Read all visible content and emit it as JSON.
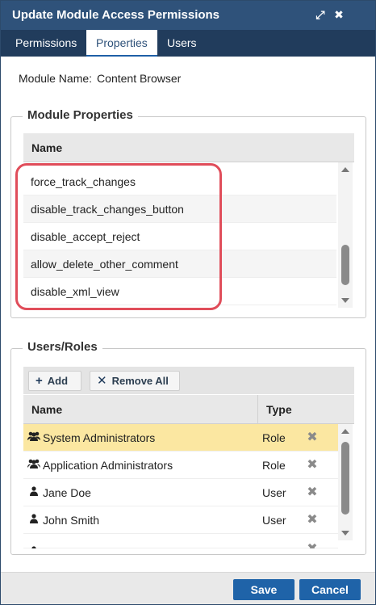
{
  "dialog": {
    "title": "Update Module Access Permissions",
    "expand_icon": "⤢",
    "close_icon": "✖"
  },
  "tabs": [
    {
      "label": "Permissions",
      "active": false
    },
    {
      "label": "Properties",
      "active": true
    },
    {
      "label": "Users",
      "active": false
    }
  ],
  "module": {
    "label": "Module Name:",
    "value": "Content Browser"
  },
  "module_properties": {
    "legend": "Module Properties",
    "column_header": "Name",
    "rows": [
      "force_track_changes",
      "disable_track_changes_button",
      "disable_accept_reject",
      "allow_delete_other_comment",
      "disable_xml_view"
    ]
  },
  "users_roles": {
    "legend": "Users/Roles",
    "add_label": "Add",
    "remove_all_label": "Remove All",
    "col_name": "Name",
    "col_type": "Type",
    "rows": [
      {
        "icon": "group-icon",
        "name": "System Administrators",
        "type": "Role",
        "selected": true
      },
      {
        "icon": "group-icon",
        "name": "Application Administrators",
        "type": "Role",
        "selected": false
      },
      {
        "icon": "user-icon",
        "name": "Jane Doe",
        "type": "User",
        "selected": false
      },
      {
        "icon": "user-icon",
        "name": "John Smith",
        "type": "User",
        "selected": false
      }
    ]
  },
  "footer": {
    "save_label": "Save",
    "cancel_label": "Cancel"
  },
  "colors": {
    "titlebar": "#2f527a",
    "tabbar": "#213c5c",
    "button": "#1f63a8",
    "selected_row": "#fbe7a1",
    "annotation": "#e04d5a"
  }
}
